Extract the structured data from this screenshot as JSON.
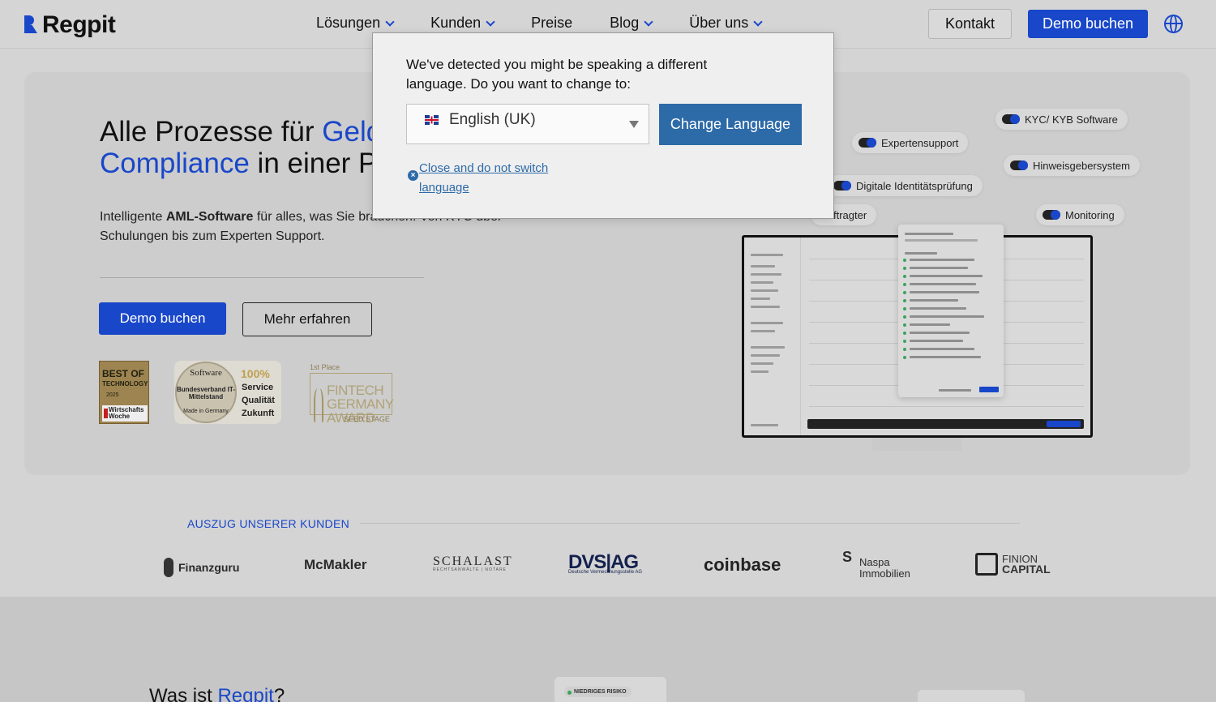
{
  "header": {
    "logo": "Regpit",
    "nav": [
      {
        "label": "Lösungen",
        "dropdown": true
      },
      {
        "label": "Kunden",
        "dropdown": true
      },
      {
        "label": "Preise",
        "dropdown": false
      },
      {
        "label": "Blog",
        "dropdown": true
      },
      {
        "label": "Über uns",
        "dropdown": true
      }
    ],
    "kontakt": "Kontakt",
    "demo": "Demo buchen",
    "globe_icon": "globe-icon"
  },
  "hero": {
    "title_a": "Alle Prozesse für ",
    "title_a_blue": "Geld",
    "title_b_blue": "Compliance",
    "title_b": " in einer P",
    "sub_pre": "Intelligente ",
    "sub_bold": "AML-Software",
    "sub_post": " für alles, was Sie brauchen. Von KYC über Schulungen bis zum Experten Support.",
    "btn_demo": "Demo buchen",
    "btn_more": "Mehr erfahren",
    "badges": {
      "best": {
        "l1": "BEST OF",
        "l2": "TECHNOLOGY",
        "year": "2025",
        "pub": "Wirtschafts Woche"
      },
      "software": {
        "ring": "Software",
        "org": "Bundesverband IT-Mittelstand",
        "made": "Made in Germany",
        "pct": "100%",
        "w1": "Service",
        "w2": "Qualität",
        "w3": "Zukunft"
      },
      "fintech": {
        "place": "1st Place",
        "t1": "FINTECH",
        "t2": "GERMANY",
        "t3": "AWARD",
        "seed": "SEED STAGE"
      }
    }
  },
  "pills": [
    "KYC/ KYB Software",
    "Expertensupport",
    "Hinweisgebersystem",
    "Digitale Identitätsprüfung",
    "ftragter",
    "Monitoring"
  ],
  "customers": {
    "label": "AUSZUG UNSERER KUNDEN",
    "logos": {
      "finanzguru": "Finanzguru",
      "mcmakler": "McMakler",
      "schalast": "SCHALAST",
      "schalast_sub": "RECHTSANWÄLTE | NOTARE",
      "dvs": "DVS|AG",
      "dvs_sub": "Deutsche Vermechnungsstelle AG",
      "coinbase": "coinbase",
      "naspa_s": "S",
      "naspa": "Naspa",
      "naspa_2": "Immobilien",
      "finion_1": "FINION",
      "finion_2": "CAPITAL"
    }
  },
  "bottom": {
    "was_pre": "Was ist ",
    "was_blue": "Regpit",
    "was_post": "?",
    "risk_chip": "NIEDRIGES RISIKO"
  },
  "dialog": {
    "message": "We've detected you might be speaking a different language. Do you want to change to:",
    "selected_language": "English (UK)",
    "change_button": "Change Language",
    "close_link": "Close and do not switch language"
  }
}
